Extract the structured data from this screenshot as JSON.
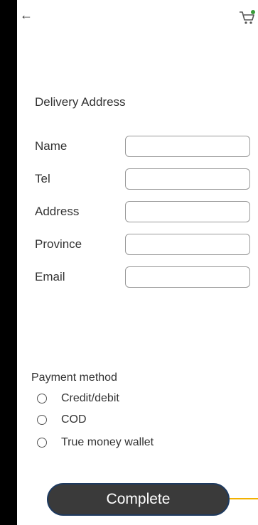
{
  "header": {
    "back_icon": "←"
  },
  "delivery": {
    "title": "Delivery Address",
    "fields": [
      {
        "label": "Name",
        "value": ""
      },
      {
        "label": "Tel",
        "value": ""
      },
      {
        "label": "Address",
        "value": ""
      },
      {
        "label": "Province",
        "value": ""
      },
      {
        "label": "Email",
        "value": ""
      }
    ]
  },
  "payment": {
    "title": "Payment method",
    "options": [
      {
        "label": "Credit/debit"
      },
      {
        "label": "COD"
      },
      {
        "label": "True money wallet"
      }
    ]
  },
  "actions": {
    "complete_label": "Complete"
  },
  "colors": {
    "cart_badge": "#3a9b3a",
    "accent_line": "#f2b100",
    "button_bg": "#3a3a3a"
  },
  "icons": [
    "back-arrow-icon",
    "cart-icon"
  ]
}
